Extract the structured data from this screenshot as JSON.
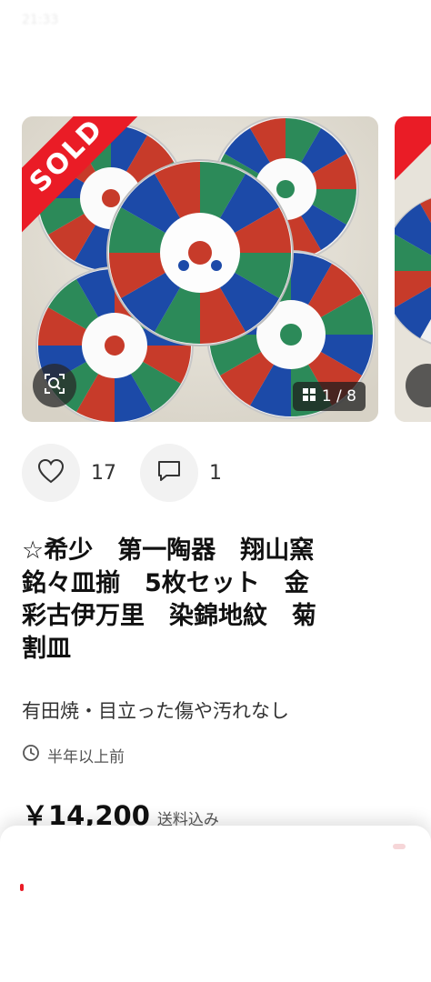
{
  "top_ghost": {
    "left": "21:33",
    "right": ""
  },
  "carousel": {
    "sold_label": "SOLD",
    "counter": "1 / 8",
    "colors": {
      "ribbon": "#ea1c26"
    }
  },
  "actions": {
    "likes": "17",
    "comments": "1"
  },
  "item": {
    "title": "☆希少　第一陶器　翔山窯\n銘々皿揃　5枚セット　金\n彩古伊万里　染錦地紋　菊\n割皿",
    "subtitle": "有田焼・目立った傷や汚れなし",
    "posted": "半年以上前",
    "price": "￥14,200",
    "shipping_note": "送料込み"
  },
  "icons": [
    "heart-icon",
    "comment-icon",
    "zoom-icon",
    "gallery-icon",
    "clock-icon"
  ]
}
